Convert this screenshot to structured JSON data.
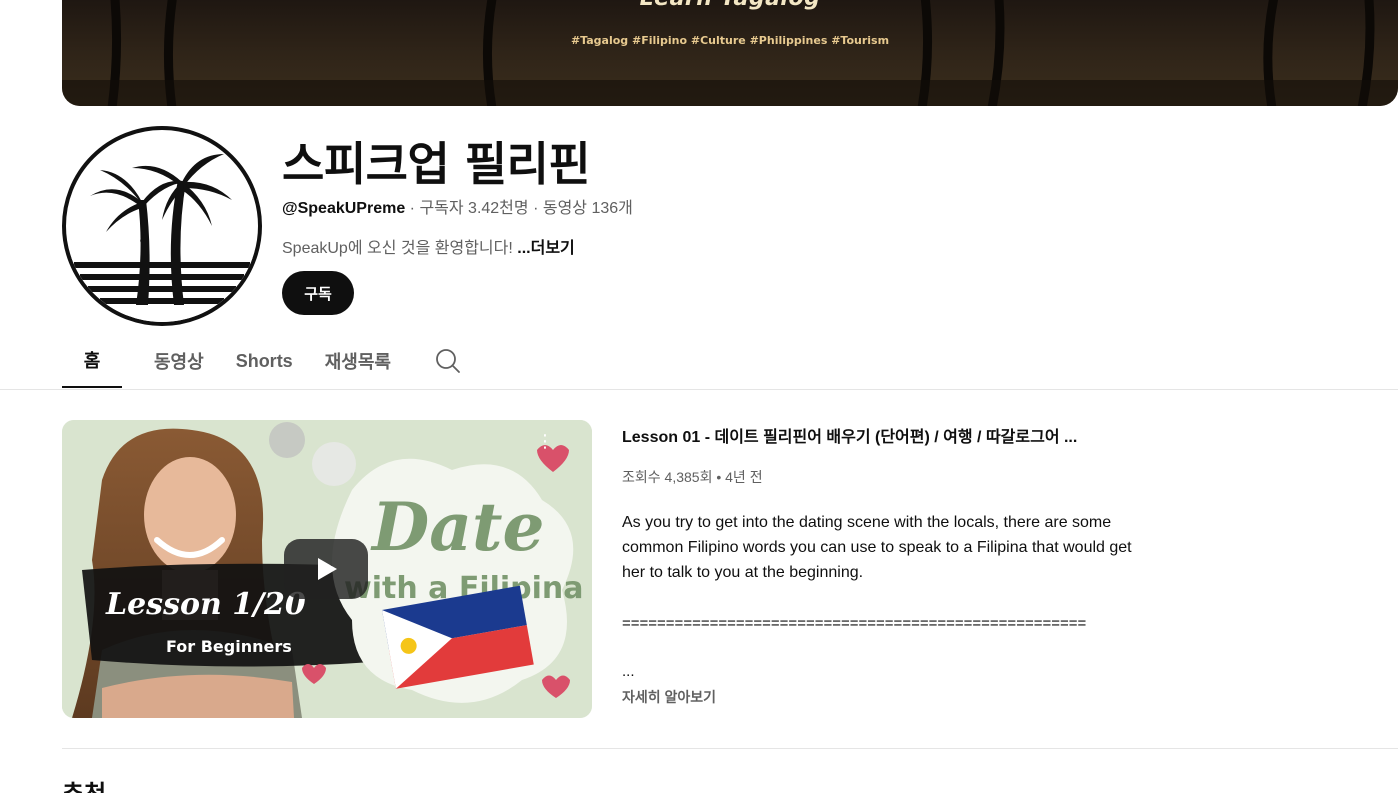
{
  "banner": {
    "title": "Learn Tagalog",
    "tags": "#Tagalog #Filipino #Culture #Philippines #Tourism"
  },
  "channel": {
    "name": "스피크업 필리핀",
    "handle": "@SpeakUPreme",
    "subscribers": "구독자 3.42천명",
    "videos": "동영상 136개",
    "separator": " · ",
    "description": "SpeakUp에 오신 것을 환영합니다!",
    "more_label": "...더보기",
    "subscribe_label": "구독"
  },
  "tabs": [
    {
      "label": "홈",
      "active": true
    },
    {
      "label": "동영상",
      "active": false
    },
    {
      "label": "Shorts",
      "active": false
    },
    {
      "label": "재생목록",
      "active": false
    }
  ],
  "featured": {
    "thumbnail": {
      "lesson_text": "Lesson 1/20",
      "level_text": "For Beginners",
      "headline_1": "Date",
      "headline_2": "with a Filipina"
    },
    "title": "Lesson 01 - 데이트 필리핀어 배우기 (단어편) / 여행 /  따갈로그어 ...",
    "views": "조회수 4,385회",
    "age": "4년 전",
    "stats_separator": " • ",
    "description": "As you try to get into the dating scene with the locals, there are some common Filipino words you can use to speak to a Filipina that would get her to talk to you at the beginning.",
    "rule": "=====================================================",
    "ellipsis": "...",
    "learn_more_label": "자세히 알아보기"
  },
  "sections": {
    "recommended_title": "추천"
  },
  "colors": {
    "accent": "#0f0f0f",
    "secondary_text": "#606060",
    "divider": "#e5e5e5"
  },
  "icons": {
    "search": "search-icon",
    "play": "play-icon",
    "more": "kebab-icon"
  }
}
